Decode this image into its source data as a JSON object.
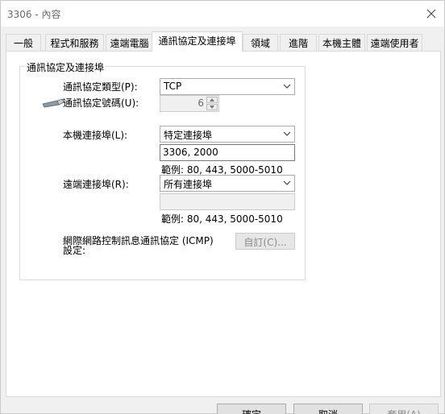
{
  "window": {
    "title": "3306 - 內容"
  },
  "tabs": [
    {
      "label": "一般"
    },
    {
      "label": "程式和服務"
    },
    {
      "label": "遠端電腦"
    },
    {
      "label": "通訊協定及連接埠"
    },
    {
      "label": "領域"
    },
    {
      "label": "進階"
    },
    {
      "label": "本機主體"
    },
    {
      "label": "遠端使用者"
    }
  ],
  "group": {
    "legend": "通訊協定及連接埠",
    "protocol_type_label": "通訊協定類型(P):",
    "protocol_type_value": "TCP",
    "protocol_number_label": "通訊協定號碼(U):",
    "protocol_number_value": "6",
    "local_port_label": "本機連接埠(L):",
    "local_port_select": "特定連接埠",
    "local_port_value": "3306, 2000",
    "local_port_hint": "範例: 80, 443, 5000-5010",
    "remote_port_label": "遠端連接埠(R):",
    "remote_port_select": "所有連接埠",
    "remote_port_value": "",
    "remote_port_hint": "範例: 80, 443, 5000-5010",
    "icmp_label_line1": "網際網路控制訊息通訊協定 (ICMP)",
    "icmp_label_line2": "設定:",
    "icmp_button": "自訂(C)..."
  },
  "buttons": {
    "ok": "確定",
    "cancel": "取消",
    "apply": "套用(A)"
  },
  "icons": {
    "close": "close-icon",
    "protocol": "plug-icon",
    "chevron": "chevron-down-icon"
  }
}
